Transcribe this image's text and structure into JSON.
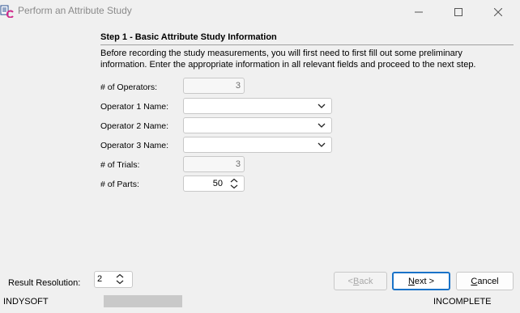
{
  "window": {
    "title": "Perform an Attribute Study"
  },
  "step": {
    "heading": "Step 1 - Basic Attribute Study Information",
    "intro_line1": "Before recording the study measurements, you will first need to first fill out some preliminary",
    "intro_line2": "information.  Enter the appropriate information in all relevant fields and proceed to the next step."
  },
  "form": {
    "operators_label": "# of Operators:",
    "operators_value": "3",
    "operator1_label": "Operator 1 Name:",
    "operator1_value": "",
    "operator2_label": "Operator 2 Name:",
    "operator2_value": "",
    "operator3_label": "Operator 3 Name:",
    "operator3_value": "",
    "trials_label": "# of Trials:",
    "trials_value": "3",
    "parts_label": "# of Parts:",
    "parts_value": "50"
  },
  "footer": {
    "result_resolution_label": "Result Resolution:",
    "result_resolution_value": "2",
    "back_prefix": "< ",
    "back_accel": "B",
    "back_rest": "ack",
    "next_accel": "N",
    "next_rest": "ext >",
    "cancel_accel": "C",
    "cancel_rest": "ancel"
  },
  "status": {
    "left": "INDYSOFT",
    "right": "INCOMPLETE",
    "progress": 0
  },
  "colors": {
    "accent": "#1a73c8",
    "progress_fill": "#06b025",
    "progress_track": "#c9c9c9"
  }
}
